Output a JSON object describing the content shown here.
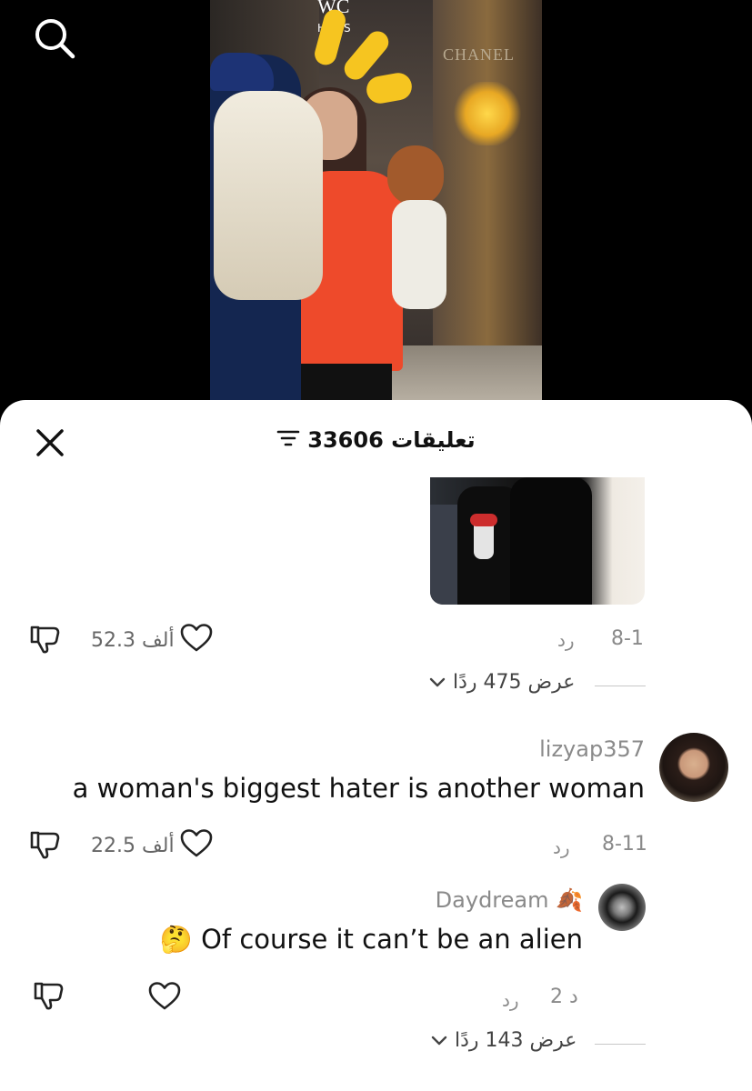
{
  "header": {
    "search_icon": "search-icon"
  },
  "video": {
    "store_text_wc": "WC",
    "store_text_haus": "HAUS",
    "store_text_chanel": "CHANEL"
  },
  "sheet": {
    "title": "33606 تعليقات",
    "close_icon": "close-icon",
    "filter_icon": "filter-icon"
  },
  "comments": [
    {
      "date": "8-1",
      "reply_label": "رد",
      "likes": "52.3 ألف",
      "has_image": true,
      "view_replies": "عرض 475 ردًا"
    },
    {
      "username": "lizyap357",
      "text": "a woman's biggest hater is another woman",
      "date": "8-11",
      "reply_label": "رد",
      "likes": "22.5 ألف"
    },
    {
      "username": "Daydream 🍂",
      "text": "🤔 Of course it can’t be an alien",
      "date": "2 د",
      "reply_label": "رد",
      "likes": "",
      "view_replies": "عرض 143 ردًا"
    }
  ]
}
